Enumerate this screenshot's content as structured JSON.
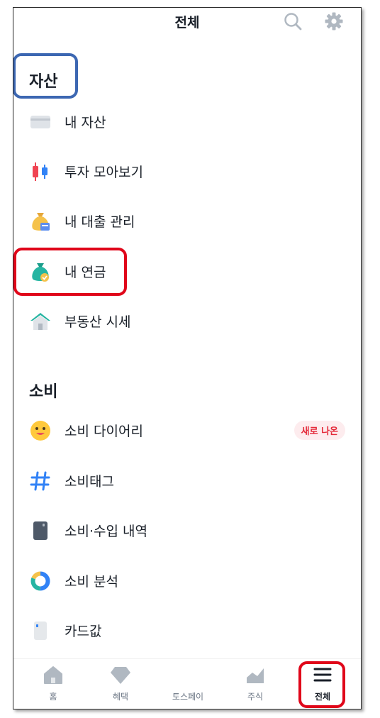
{
  "header": {
    "title": "전체"
  },
  "sections": {
    "assets": {
      "title": "자산",
      "items": [
        {
          "label": "내 자산",
          "icon": "card-icon"
        },
        {
          "label": "투자 모아보기",
          "icon": "candlestick-icon"
        },
        {
          "label": "내 대출 관리",
          "icon": "loan-bag-icon"
        },
        {
          "label": "내 연금",
          "icon": "pension-bag-icon"
        },
        {
          "label": "부동산 시세",
          "icon": "house-icon"
        }
      ]
    },
    "spending": {
      "title": "소비",
      "items": [
        {
          "label": "소비 다이어리",
          "icon": "smiley-icon",
          "badge": "새로 나온"
        },
        {
          "label": "소비태그",
          "icon": "hashtag-icon"
        },
        {
          "label": "소비·수입 내역",
          "icon": "notebook-icon"
        },
        {
          "label": "소비 분석",
          "icon": "donut-chart-icon"
        },
        {
          "label": "카드값",
          "icon": "card-bill-icon"
        }
      ]
    }
  },
  "tabbar": {
    "tabs": [
      {
        "label": "홈",
        "icon": "home-icon"
      },
      {
        "label": "혜택",
        "icon": "gem-icon"
      },
      {
        "label": "토스페이",
        "icon": "pay-icon"
      },
      {
        "label": "주식",
        "icon": "chart-icon"
      },
      {
        "label": "전체",
        "icon": "hamburger-icon",
        "active": true
      }
    ]
  },
  "colors": {
    "highlight_blue": "#3c67b2",
    "highlight_red": "#e0061a",
    "text_primary": "#191f28",
    "text_secondary": "#6b7684",
    "badge_bg": "#fdecee",
    "badge_text": "#e42939"
  }
}
